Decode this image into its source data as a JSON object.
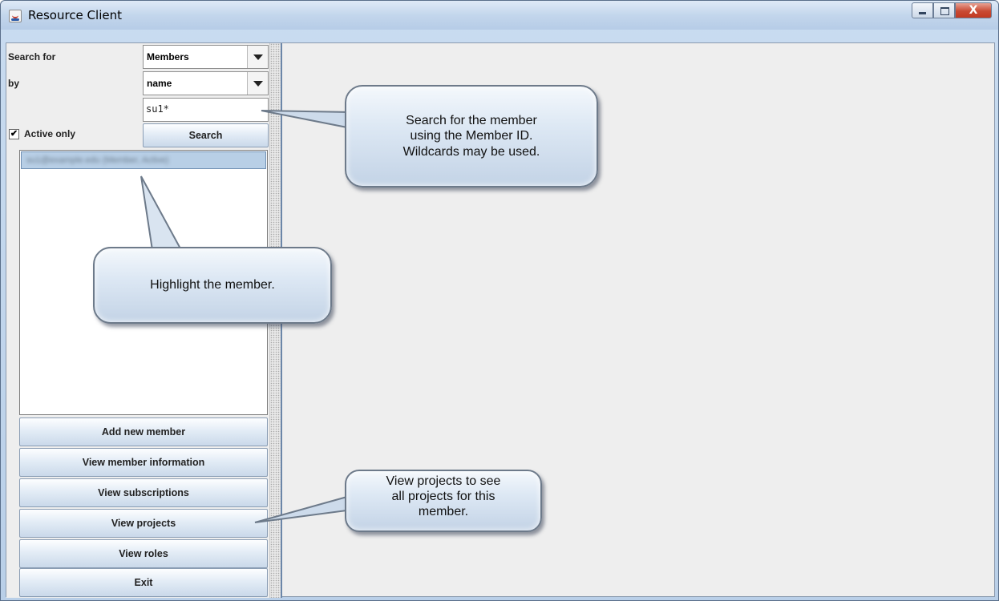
{
  "window": {
    "title": "Resource Client",
    "close_label": "X"
  },
  "form": {
    "search_for_label": "Search for",
    "search_for_value": "Members",
    "by_label": "by",
    "by_value": "name",
    "query_value": "su1*",
    "active_only_label": "Active only",
    "active_only_checked": true,
    "search_button": "Search"
  },
  "results": {
    "items": [
      "su1@example.edu (Member, Active)"
    ]
  },
  "actions": [
    "Add new member",
    "View member information",
    "View subscriptions",
    "View projects",
    "View roles",
    "Exit"
  ],
  "callouts": {
    "search_tip": "Search for the member\nusing the Member ID.\nWildcards may be used.",
    "highlight_tip": "Highlight the member.",
    "projects_tip": "View projects to see\nall projects for this\nmember."
  },
  "colors": {
    "title_bar": "#c3d6ec",
    "selection": "#b8cfe6",
    "close_button": "#c94a33",
    "callout_border": "#6d7a8a"
  }
}
